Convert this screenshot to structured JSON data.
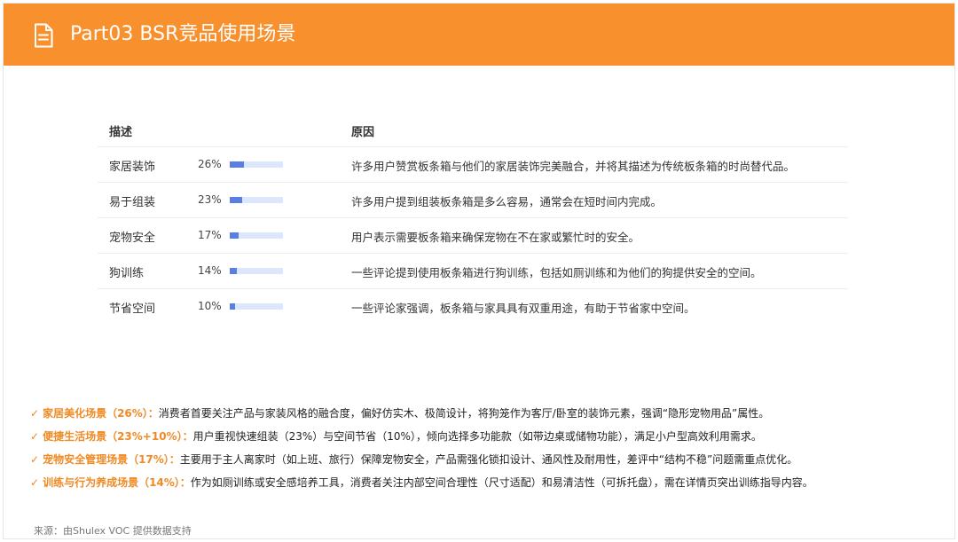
{
  "header": {
    "title": "Part03 BSR竞品使用场景",
    "bg_color": "#f7902d",
    "icon": "document-icon"
  },
  "table": {
    "columns": {
      "desc": "描述",
      "reason": "原因"
    },
    "rows": [
      {
        "desc": "家居装饰",
        "pct": "26%",
        "share": 0.26,
        "reason": "许多用户赞赏板条箱与他们的家居装饰完美融合，并将其描述为传统板条箱的时尚替代品。"
      },
      {
        "desc": "易于组装",
        "pct": "23%",
        "share": 0.23,
        "reason": "许多用户提到组装板条箱是多么容易，通常会在短时间内完成。"
      },
      {
        "desc": "宠物安全",
        "pct": "17%",
        "share": 0.17,
        "reason": "用户表示需要板条箱来确保宠物在不在家或繁忙时的安全。"
      },
      {
        "desc": "狗训练",
        "pct": "14%",
        "share": 0.14,
        "reason": "一些评论提到使用板条箱进行狗训练，包括如厕训练和为他们的狗提供安全的空间。"
      },
      {
        "desc": "节省空间",
        "pct": "10%",
        "share": 0.1,
        "reason": "一些评论家强调，板条箱与家具具有双重用途，有助于节省家中空间。"
      }
    ],
    "bar_fill_color": "#5b7fe0",
    "bar_track_color": "#dde7fb"
  },
  "bullets": [
    {
      "check": "✓",
      "head": "家居美化场景（26%）：",
      "body": "消费者首要关注产品与家装风格的融合度，偏好仿实木、极简设计，将狗笼作为客厅/卧室的装饰元素，强调“隐形宠物用品”属性。"
    },
    {
      "check": "✓",
      "head": "便捷生活场景（23%+10%）：",
      "body": "用户重视快速组装（23%）与空间节省（10%），倾向选择多功能款（如带边桌或储物功能），满足小户型高效利用需求。"
    },
    {
      "check": "✓",
      "head": "宠物安全管理场景（17%）：",
      "body": "主要用于主人离家时（如上班、旅行）保障宠物安全，产品需强化锁扣设计、通风性及耐用性，差评中“结构不稳”问题需重点优化。"
    },
    {
      "check": "✓",
      "head": "训练与行为养成场景（14%）：",
      "body": "作为如厕训练或安全感培养工具，消费者关注内部空间合理性（尺寸适配）和易清洁性（可拆托盘），需在详情页突出训练指导内容。"
    }
  ],
  "accent_color": "#f08a24",
  "source": "来源：由Shulex VOC 提供数据支持"
}
